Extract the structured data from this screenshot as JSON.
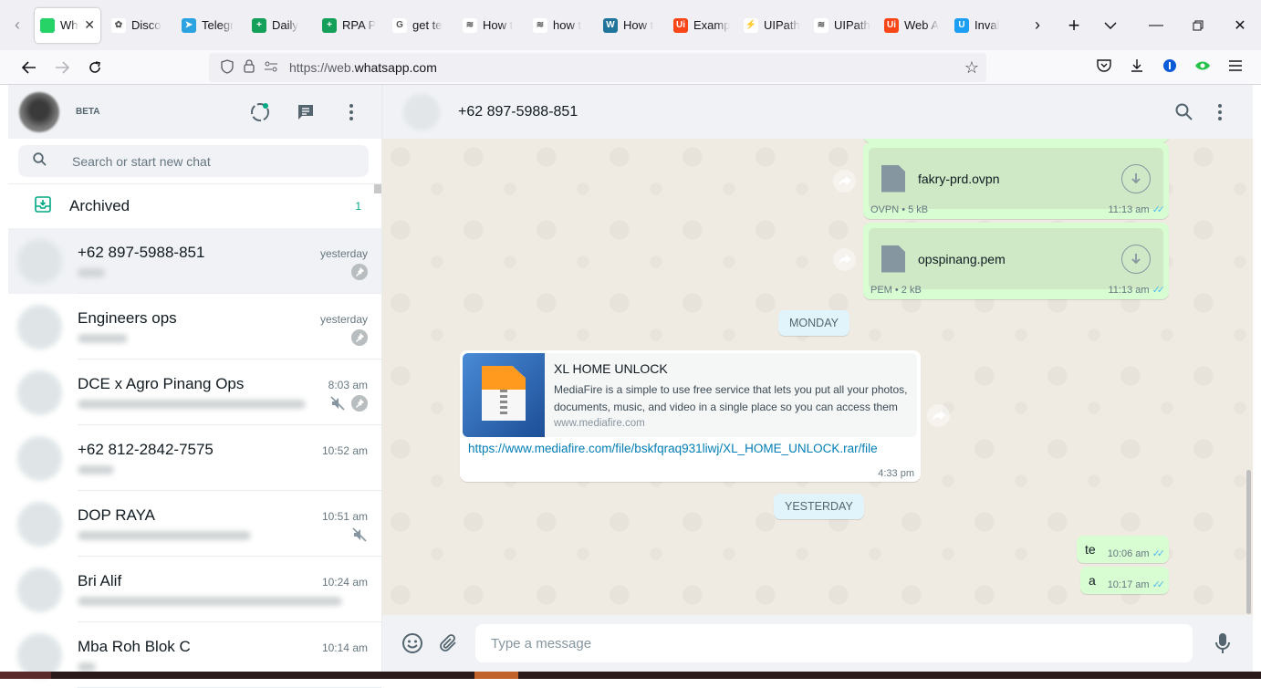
{
  "browser": {
    "tabs": [
      {
        "title": "Wh",
        "favicon_color": "#25d366",
        "favicon_glyph": "",
        "active": true
      },
      {
        "title": "Disco",
        "favicon_color": "#ffffff",
        "favicon_glyph": "✿",
        "active": false
      },
      {
        "title": "Telegr",
        "favicon_color": "#2aa3e0",
        "favicon_glyph": "➤",
        "active": false
      },
      {
        "title": "Daily",
        "favicon_color": "#14a05a",
        "favicon_glyph": "+",
        "active": false
      },
      {
        "title": "RPA P",
        "favicon_color": "#14a05a",
        "favicon_glyph": "+",
        "active": false
      },
      {
        "title": "get te",
        "favicon_color": "#ffffff",
        "favicon_glyph": "G",
        "active": false
      },
      {
        "title": "How t",
        "favicon_color": "#ffffff",
        "favicon_glyph": "≋",
        "active": false
      },
      {
        "title": "how t",
        "favicon_color": "#ffffff",
        "favicon_glyph": "≋",
        "active": false
      },
      {
        "title": "How t",
        "favicon_color": "#21759b",
        "favicon_glyph": "W",
        "active": false
      },
      {
        "title": "Examp",
        "favicon_color": "#fa4616",
        "favicon_glyph": "Ui",
        "active": false
      },
      {
        "title": "UIPath",
        "favicon_color": "#ffffff",
        "favicon_glyph": "⚡",
        "active": false
      },
      {
        "title": "UIPath",
        "favicon_color": "#ffffff",
        "favicon_glyph": "≋",
        "active": false
      },
      {
        "title": "Web A",
        "favicon_color": "#fa4616",
        "favicon_glyph": "Ui",
        "active": false
      },
      {
        "title": "Inval",
        "favicon_color": "#1c9ef5",
        "favicon_glyph": "U",
        "active": false
      }
    ],
    "url_prefix": "https://web.",
    "url_domain": "whatsapp.com"
  },
  "sidebar": {
    "beta_label": "BETA",
    "search_placeholder": "Search or start new chat",
    "archived": {
      "label": "Archived",
      "count": "1"
    },
    "chats": [
      {
        "name": "+62 897-5988-851",
        "time": "yesterday",
        "preview_width": 30,
        "pinned": true,
        "muted": false,
        "selected": true
      },
      {
        "name": "Engineers ops",
        "time": "yesterday",
        "preview_width": 55,
        "pinned": true,
        "muted": false,
        "selected": false
      },
      {
        "name": "DCE x Agro Pinang Ops",
        "time": "8:03 am",
        "preview_width": 250,
        "pinned": true,
        "muted": true,
        "selected": false
      },
      {
        "name": "+62 812-2842-7575",
        "time": "10:52 am",
        "preview_width": 40,
        "pinned": false,
        "muted": false,
        "selected": false
      },
      {
        "name": "DOP RAYA",
        "time": "10:51 am",
        "preview_width": 190,
        "pinned": false,
        "muted": true,
        "selected": false
      },
      {
        "name": "Bri Alif",
        "time": "10:24 am",
        "preview_width": 290,
        "pinned": false,
        "muted": false,
        "selected": false
      },
      {
        "name": "Mba Roh Blok C",
        "time": "10:14 am",
        "preview_width": 20,
        "pinned": false,
        "muted": false,
        "selected": false
      }
    ]
  },
  "conversation": {
    "contact_name": "+62 897-5988-851",
    "files": [
      {
        "name": "fakry-prd.ovpn",
        "meta": "OVPN • 5 kB",
        "time": "11:13 am"
      },
      {
        "name": "opspinang.pem",
        "meta": "PEM • 2 kB",
        "time": "11:13 am"
      }
    ],
    "day_monday": "MONDAY",
    "link_message": {
      "title": "XL HOME UNLOCK",
      "description": "MediaFire is a simple to use free service that lets you put all your photos, documents, music, and video in a single place so you can access them",
      "domain": "www.mediafire.com",
      "url": "https://www.mediafire.com/file/bskfqraq931liwj/XL_HOME_UNLOCK.rar/file",
      "time": "4:33 pm"
    },
    "day_yesterday": "YESTERDAY",
    "out_messages": [
      {
        "text": "te",
        "time": "10:06 am"
      },
      {
        "text": "a",
        "time": "10:17 am"
      }
    ],
    "composer_placeholder": "Type a message"
  },
  "colors": {
    "accent": "#00a884",
    "outgoing_bubble": "#d9fdd3",
    "read_ticks": "#53bdeb",
    "link": "#027eb5"
  }
}
